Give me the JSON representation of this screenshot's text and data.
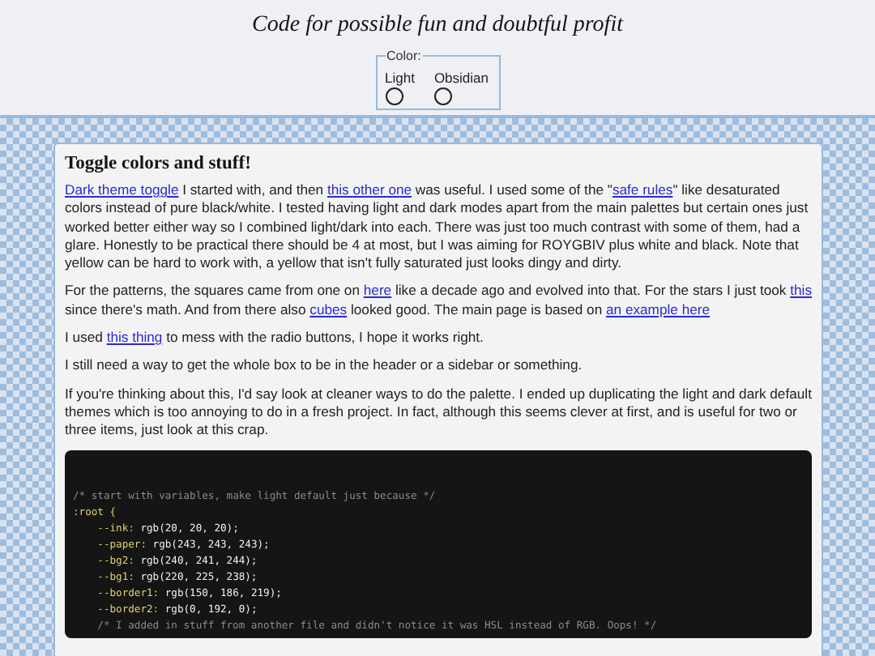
{
  "header": {
    "title": "Code for possible fun and doubtful profit",
    "color_picker": {
      "legend": "Color:",
      "options": [
        {
          "label": "Light",
          "selected": false
        },
        {
          "label": "Obsidian",
          "selected": false
        }
      ]
    }
  },
  "article": {
    "heading": "Toggle colors and stuff!",
    "paragraphs": [
      {
        "parts": [
          {
            "kind": "link",
            "text": "Dark theme toggle"
          },
          {
            "kind": "text",
            "text": " I started with, and then "
          },
          {
            "kind": "link",
            "text": "this other one"
          },
          {
            "kind": "text",
            "text": " was useful. I used some of the \""
          },
          {
            "kind": "link",
            "text": "safe rules"
          },
          {
            "kind": "text",
            "text": "\" like desaturated colors instead of pure black/white. I tested having light and dark modes apart from the main palettes but certain ones just worked better either way so I combined light/dark into each. There was just too much contrast with some of them, had a glare. Honestly to be practical there should be 4 at most, but I was aiming for ROYGBIV plus white and black. Note that yellow can be hard to work with, a yellow that isn't fully saturated just looks dingy and dirty."
          }
        ]
      },
      {
        "parts": [
          {
            "kind": "text",
            "text": "For the patterns, the squares came from one on "
          },
          {
            "kind": "link",
            "text": "here"
          },
          {
            "kind": "text",
            "text": " like a decade ago and evolved into that. For the stars I just took "
          },
          {
            "kind": "link",
            "text": "this"
          },
          {
            "kind": "text",
            "text": " since there's math. And from there also "
          },
          {
            "kind": "link",
            "text": "cubes"
          },
          {
            "kind": "text",
            "text": " looked good. The main page is based on "
          },
          {
            "kind": "link",
            "text": "an example here"
          }
        ]
      },
      {
        "parts": [
          {
            "kind": "text",
            "text": "I used "
          },
          {
            "kind": "link",
            "text": "this thing"
          },
          {
            "kind": "text",
            "text": " to mess with the radio buttons, I hope it works right."
          }
        ]
      },
      {
        "parts": [
          {
            "kind": "text",
            "text": "I still need a way to get the whole box to be in the header or a sidebar or something."
          }
        ]
      },
      {
        "parts": [
          {
            "kind": "text",
            "text": "If you're thinking about this, I'd say look at cleaner ways to do the palette. I ended up duplicating the light and dark default themes which is too annoying to do in a fresh project. In fact, although this seems clever at first, and is useful for two or three items, just look at this crap."
          }
        ]
      }
    ],
    "code": [
      {
        "kind": "comment",
        "text": "/* start with variables, make light default just because */"
      },
      {
        "kind": "selector",
        "text": ":root {",
        "children": [
          {
            "kind": "property",
            "name": "--ink:",
            "value": " rgb(20, 20, 20);"
          },
          {
            "kind": "property",
            "name": "--paper:",
            "value": " rgb(243, 243, 243);"
          },
          {
            "kind": "property",
            "name": "--bg2:",
            "value": " rgb(240, 241, 244);"
          },
          {
            "kind": "property",
            "name": "--bg1:",
            "value": " rgb(220, 225, 238);"
          },
          {
            "kind": "property",
            "name": "--border1:",
            "value": " rgb(150, 186, 219);"
          },
          {
            "kind": "property",
            "name": "--border2:",
            "value": " rgb(0, 192, 0);"
          },
          {
            "kind": "comment",
            "text": "/* I added in stuff from another file and didn't notice it was HSL instead of RGB. Oops! */"
          }
        ]
      }
    ]
  }
}
